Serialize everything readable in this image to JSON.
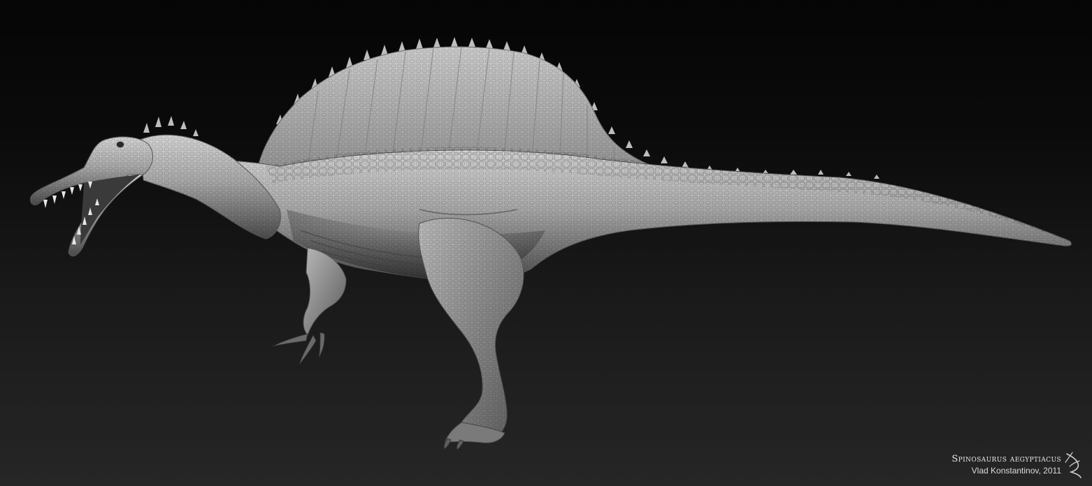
{
  "image": {
    "subject": "spinosaurus-sculpt",
    "background_top": "#050505",
    "background_bottom": "#262626",
    "skin_light": "#cfcfcf",
    "skin_mid": "#8c8c8c",
    "skin_dark": "#3c3c3c"
  },
  "caption": {
    "title": "Spinosaurus aegyptiacus",
    "credit": "Vlad Konstantinov, 2011"
  },
  "signature": {
    "icon": "signature-mark-icon",
    "text": "VK"
  }
}
